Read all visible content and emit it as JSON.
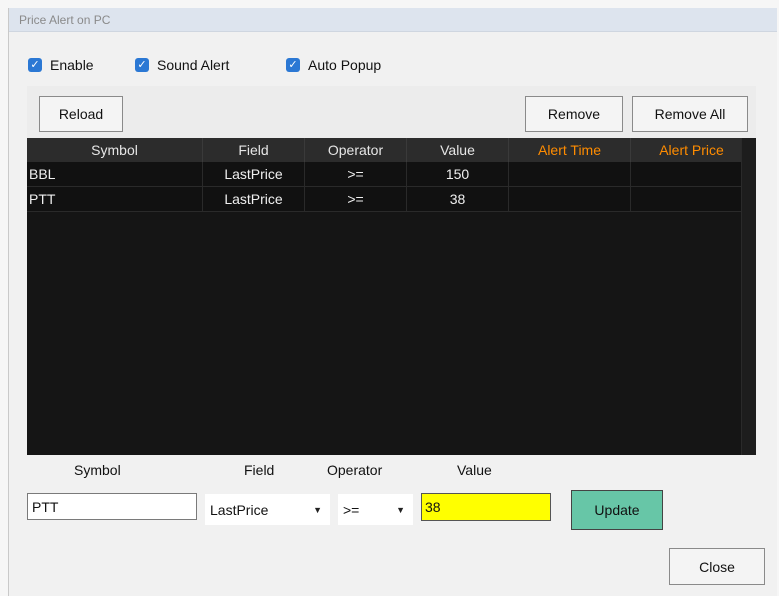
{
  "window": {
    "title": "Price Alert on PC"
  },
  "options": {
    "enable_label": "Enable",
    "sound_alert_label": "Sound Alert",
    "auto_popup_label": "Auto Popup",
    "check_mark": "✓"
  },
  "toolbar": {
    "reload_label": "Reload",
    "remove_label": "Remove",
    "remove_all_label": "Remove All"
  },
  "grid": {
    "columns": [
      "Symbol",
      "Field",
      "Operator",
      "Value",
      "Alert Time",
      "Alert Price"
    ],
    "rows": [
      {
        "symbol": "BBL",
        "field": "LastPrice",
        "operator": ">=",
        "value": "150",
        "alert_time": "",
        "alert_price": ""
      },
      {
        "symbol": "PTT",
        "field": "LastPrice",
        "operator": ">=",
        "value": "38",
        "alert_time": "",
        "alert_price": ""
      }
    ]
  },
  "editor": {
    "symbol_label": "Symbol",
    "field_label": "Field",
    "operator_label": "Operator",
    "value_label": "Value",
    "symbol_value": "PTT",
    "field_value": "LastPrice",
    "operator_value": ">=",
    "value_value": "38",
    "dropdown_arrow": "▼",
    "update_label": "Update"
  },
  "footer": {
    "close_label": "Close"
  },
  "colors": {
    "accent_check": "#2b78d4",
    "orange_header": "#ff8c00",
    "value_highlight": "#ffff00",
    "update_button": "#67c6a7"
  }
}
